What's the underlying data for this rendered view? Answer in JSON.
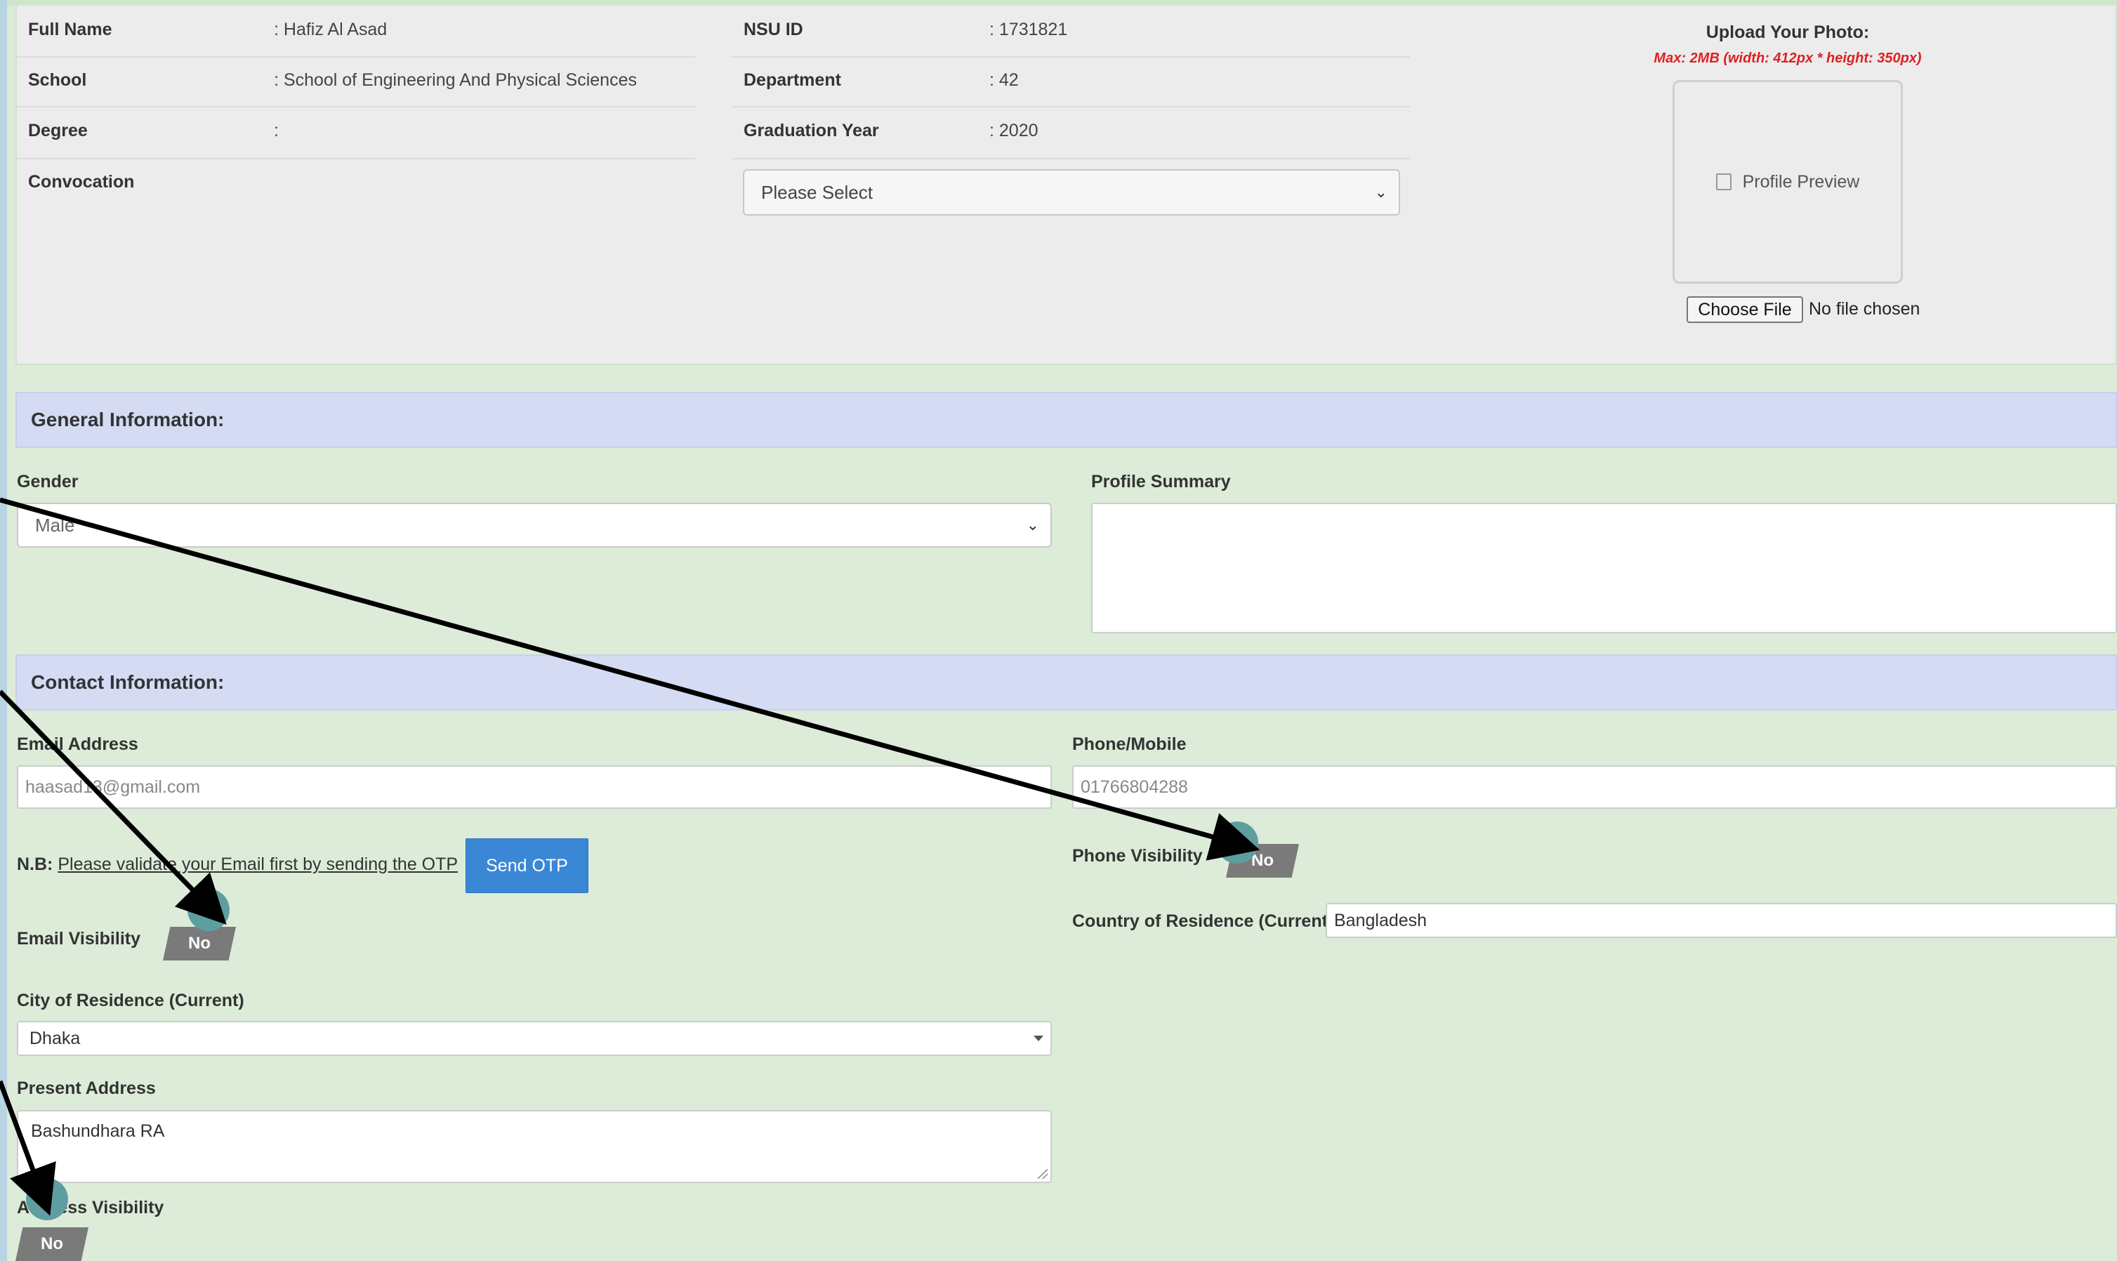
{
  "personal": {
    "full_name_label": "Full Name",
    "full_name_value": ": Hafiz Al Asad",
    "school_label": "School",
    "school_value": ": School of Engineering And Physical Sciences",
    "degree_label": "Degree",
    "degree_value": ":",
    "convocation_label": "Convocation",
    "nsu_id_label": "NSU ID",
    "nsu_id_value": ": 1731821",
    "department_label": "Department",
    "department_value": ": 42",
    "graduation_year_label": "Graduation Year",
    "graduation_year_value": ": 2020",
    "convocation_select": "Please Select"
  },
  "upload": {
    "title": "Upload Your Photo:",
    "max_note": "Max: 2MB (width: 412px * height: 350px)",
    "preview_alt": "Profile Preview",
    "choose_file": "Choose File",
    "no_file": "No file chosen"
  },
  "general": {
    "section_title": "General Information:",
    "gender_label": "Gender",
    "gender_value": "Male",
    "profile_summary_label": "Profile Summary",
    "profile_summary_value": ""
  },
  "contact": {
    "section_title": "Contact Information:",
    "email_label": "Email Address",
    "email_value": "haasad13@gmail.com",
    "phone_label": "Phone/Mobile",
    "phone_value": "01766804288",
    "nb_prefix": "N.B:",
    "nb_text": "Please validate your Email first by sending the OTP",
    "send_otp": "Send OTP",
    "email_visibility_label": "Email Visibility",
    "email_visibility_value": "No",
    "phone_visibility_label": "Phone Visibility",
    "phone_visibility_value": "No",
    "country_label": "Country of Residence (Current)",
    "country_value": "Bangladesh",
    "city_label": "City of Residence (Current)",
    "city_value": "Dhaka",
    "present_address_label": "Present Address",
    "present_address_value": "Bashundhara RA",
    "address_visibility_label": "Address Visibility",
    "address_visibility_value": "No"
  },
  "colors": {
    "page_background": "#dcecd8",
    "section_header": "#d4dbf3",
    "otp_button": "#3a87d6",
    "toggle_off": "#7a7a7a",
    "annotation_marker": "#5f9ea0",
    "upload_note": "#e02020"
  }
}
